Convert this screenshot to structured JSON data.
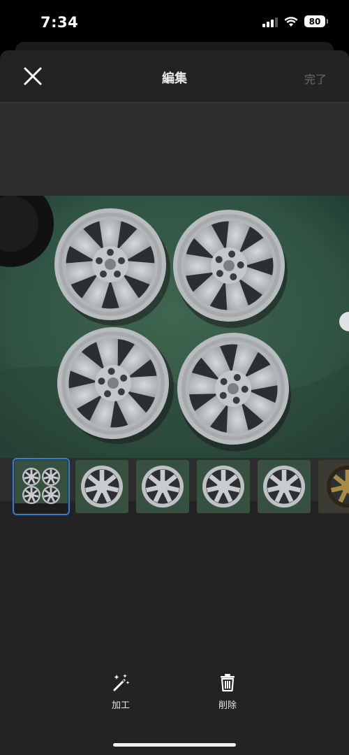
{
  "status": {
    "time": "7:34",
    "battery": "80"
  },
  "nav": {
    "title": "編集",
    "done_label": "完了"
  },
  "toolbar": {
    "edit_label": "加工",
    "delete_label": "削除"
  },
  "thumbnails": [
    {
      "name": "thumbnail-1",
      "selected": true,
      "content": "four-wheels"
    },
    {
      "name": "thumbnail-2",
      "selected": false,
      "content": "single-wheel"
    },
    {
      "name": "thumbnail-3",
      "selected": false,
      "content": "single-wheel"
    },
    {
      "name": "thumbnail-4",
      "selected": false,
      "content": "single-wheel"
    },
    {
      "name": "thumbnail-5",
      "selected": false,
      "content": "single-wheel"
    },
    {
      "name": "thumbnail-6",
      "selected": false,
      "content": "gold-wheel"
    }
  ],
  "colors": {
    "accent": "#2f7fd6",
    "sheet": "#232323",
    "photo_bg": "#2d2d2d"
  }
}
